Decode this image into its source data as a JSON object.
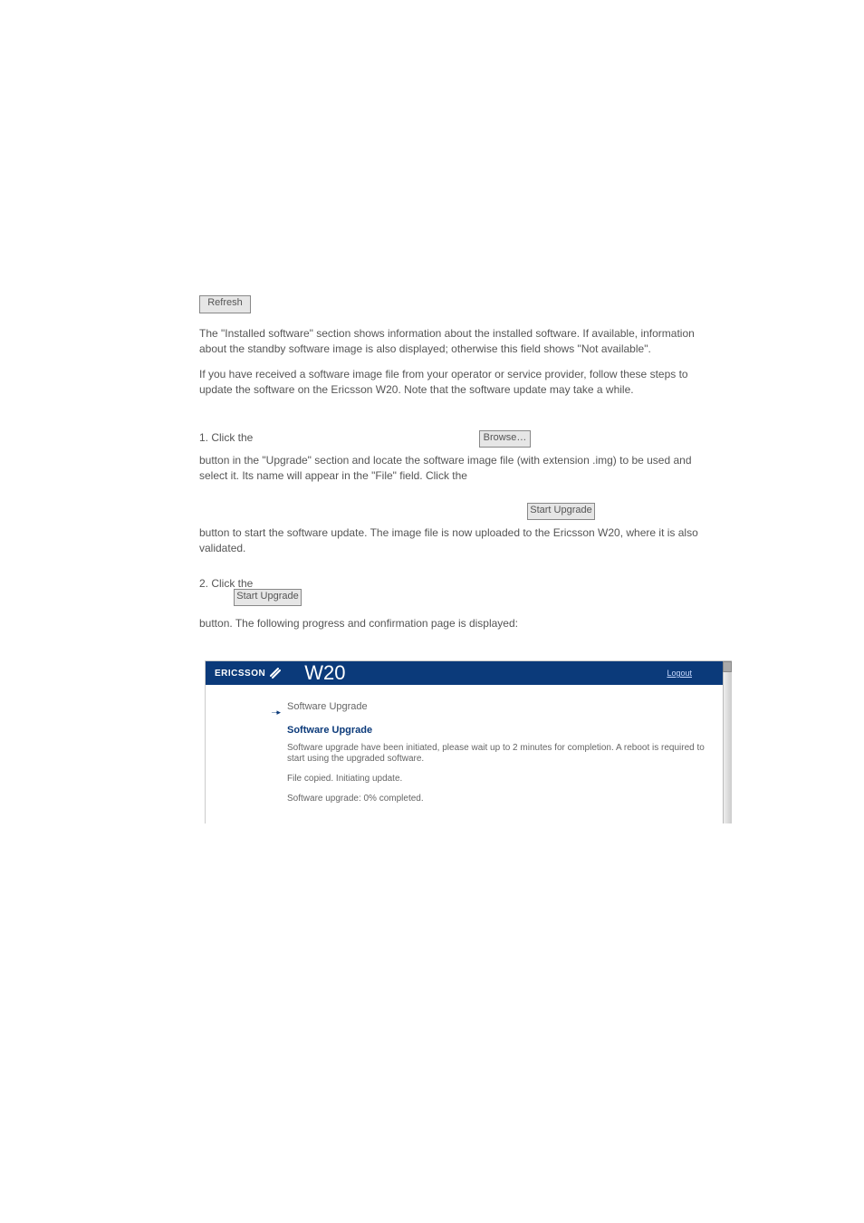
{
  "doc": {
    "refresh_btn": "Refresh",
    "p1": "The \"Installed software\" section shows information about the installed software. If available, information about the standby software image is also displayed; otherwise this field shows \"Not available\".",
    "p2": "If you have received a software image file from your operator or service provider, follow these steps to update the software on the Ericsson W20. Note that the software update may take a while.",
    "p3_lead": "1.  Click the ",
    "browse_btn": "Browse…",
    "p4": " button in the \"Upgrade\" section and locate the software image file (with extension .img) to be used and select it. Its name will appear in the \"File\" field. Click the",
    "start_upgrade_btn": "Start Upgrade",
    "p5": " button to start the software update. The image file is now uploaded to the Ericsson W20, where it is also validated.",
    "p6_lead": "2.  Click the ",
    "p7": "button.  The following progress and confirmation page is displayed:"
  },
  "mock": {
    "brand": "ERICSSON",
    "model": "W20",
    "logout": "Logout",
    "breadcrumb": "Software Upgrade",
    "heading": "Software Upgrade",
    "msg1": "Software upgrade have been initiated, please wait up to 2 minutes for completion. A reboot is required to start using the upgraded software.",
    "msg2": "File copied. Initiating update.",
    "msg3": "Software upgrade: 0% completed."
  }
}
